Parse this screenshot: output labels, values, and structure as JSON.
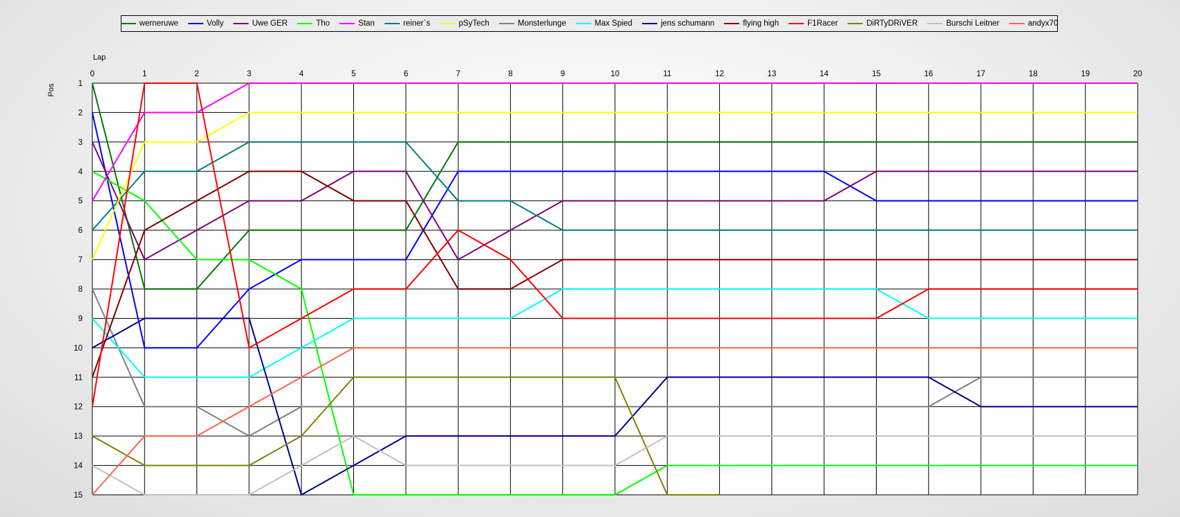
{
  "chart_data": {
    "type": "line",
    "xlabel": "Lap",
    "ylabel": "Pos",
    "xlim": [
      0,
      20
    ],
    "ylim": [
      1,
      15
    ],
    "y_inverted": true,
    "grid": true,
    "legend_position": "top",
    "x": [
      0,
      1,
      2,
      3,
      4,
      5,
      6,
      7,
      8,
      9,
      10,
      11,
      12,
      13,
      14,
      15,
      16,
      17,
      18,
      19,
      20
    ],
    "x_ticks": [
      "0",
      "1",
      "2",
      "3",
      "4",
      "5",
      "6",
      "7",
      "8",
      "9",
      "10",
      "11",
      "12",
      "13",
      "14",
      "15",
      "16",
      "17",
      "18",
      "19",
      "20"
    ],
    "y_ticks": [
      "1",
      "2",
      "3",
      "4",
      "5",
      "6",
      "7",
      "8",
      "9",
      "10",
      "11",
      "12",
      "13",
      "14",
      "15"
    ],
    "series": [
      {
        "name": "werneruwe",
        "color": "#007800",
        "values": [
          1,
          8,
          8,
          6,
          6,
          6,
          6,
          3,
          3,
          3,
          3,
          3,
          3,
          3,
          3,
          3,
          3,
          3,
          3,
          3,
          3
        ]
      },
      {
        "name": "Volly",
        "color": "#0000ff",
        "values": [
          2,
          10,
          10,
          8,
          7,
          7,
          7,
          4,
          4,
          4,
          4,
          4,
          4,
          4,
          4,
          5,
          5,
          5,
          5,
          5,
          5
        ]
      },
      {
        "name": "Uwe GER",
        "color": "#800080",
        "values": [
          3,
          7,
          6,
          5,
          5,
          4,
          4,
          7,
          6,
          5,
          5,
          5,
          5,
          5,
          5,
          4,
          4,
          4,
          4,
          4,
          4
        ]
      },
      {
        "name": "Tho",
        "color": "#00ff00",
        "values": [
          4,
          5,
          7,
          7,
          8,
          15,
          15,
          15,
          15,
          15,
          15,
          14,
          14,
          14,
          14,
          14,
          14,
          14,
          14,
          14,
          14
        ]
      },
      {
        "name": "Stan",
        "color": "#ff00ff",
        "values": [
          5,
          2,
          2,
          1,
          1,
          1,
          1,
          1,
          1,
          1,
          1,
          1,
          1,
          1,
          1,
          1,
          1,
          1,
          1,
          1,
          1
        ]
      },
      {
        "name": "reiner`s",
        "color": "#008080",
        "values": [
          6,
          4,
          4,
          3,
          3,
          3,
          3,
          5,
          5,
          6,
          6,
          6,
          6,
          6,
          6,
          6,
          6,
          6,
          6,
          6,
          6
        ]
      },
      {
        "name": "pSyTech",
        "color": "#ffff00",
        "values": [
          7,
          3,
          3,
          2,
          2,
          2,
          2,
          2,
          2,
          2,
          2,
          2,
          2,
          2,
          2,
          2,
          2,
          2,
          2,
          2,
          2
        ]
      },
      {
        "name": "Monsterlunge",
        "color": "#808080",
        "values": [
          8,
          12,
          12,
          13,
          12,
          12,
          12,
          12,
          12,
          12,
          12,
          12,
          12,
          12,
          12,
          12,
          12,
          11,
          11,
          11,
          11
        ]
      },
      {
        "name": "Max Spied",
        "color": "#00ffff",
        "values": [
          9,
          11,
          11,
          11,
          10,
          9,
          9,
          9,
          9,
          8,
          8,
          8,
          8,
          8,
          8,
          8,
          9,
          9,
          9,
          9,
          9
        ]
      },
      {
        "name": "jens  schumann",
        "color": "#00008b",
        "values": [
          10,
          9,
          9,
          9,
          15,
          14,
          13,
          13,
          13,
          13,
          13,
          11,
          11,
          11,
          11,
          11,
          11,
          12,
          12,
          12,
          12
        ]
      },
      {
        "name": "flying high",
        "color": "#800000",
        "values": [
          11,
          6,
          5,
          4,
          4,
          5,
          5,
          8,
          8,
          7,
          7,
          7,
          7,
          7,
          7,
          7,
          7,
          7,
          7,
          7,
          7
        ]
      },
      {
        "name": "F1Racer",
        "color": "#ff0000",
        "values": [
          12,
          1,
          1,
          10,
          9,
          8,
          8,
          6,
          7,
          9,
          9,
          9,
          9,
          9,
          9,
          9,
          8,
          8,
          8,
          8,
          8
        ]
      },
      {
        "name": "DiRTyDRiVER",
        "color": "#808000",
        "values": [
          13,
          14,
          14,
          14,
          13,
          11,
          11,
          11,
          11,
          11,
          11,
          15,
          15
        ]
      },
      {
        "name": "Burschi Leitner",
        "color": "#c0c0c0",
        "values": [
          14,
          15,
          15,
          15,
          14,
          13,
          14,
          14,
          14,
          14,
          14,
          13,
          13,
          13,
          13,
          13,
          13,
          13,
          13,
          13,
          13
        ]
      },
      {
        "name": "andyx70",
        "color": "#ff6347",
        "values": [
          15,
          13,
          13,
          12,
          11,
          10,
          10,
          10,
          10,
          10,
          10,
          10,
          10,
          10,
          10,
          10,
          10,
          10,
          10,
          10,
          10
        ]
      }
    ]
  }
}
